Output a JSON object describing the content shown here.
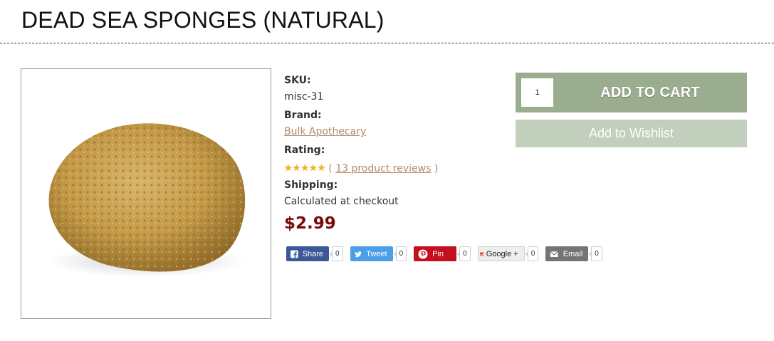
{
  "page": {
    "title": "DEAD SEA SPONGES (NATURAL)"
  },
  "product": {
    "image_alt": "Dead sea sponge",
    "sku_label": "SKU:",
    "sku_value": "misc-31",
    "brand_label": "Brand:",
    "brand_value": "Bulk Apothecary",
    "rating_label": "Rating:",
    "rating_stars": 5,
    "reviews_open": "(",
    "reviews_link": "13 product reviews",
    "reviews_close": ")",
    "shipping_label": "Shipping:",
    "shipping_value": "Calculated at checkout",
    "price": "$2.99"
  },
  "cart": {
    "quantity": "1",
    "add_to_cart_label": "ADD TO CART",
    "wishlist_label": "Add to Wishlist"
  },
  "share": [
    {
      "label": "Share",
      "count": "0",
      "icon": "facebook-icon"
    },
    {
      "label": "Tweet",
      "count": "0",
      "icon": "twitter-icon"
    },
    {
      "label": "Pin",
      "count": "0",
      "icon": "pinterest-icon"
    },
    {
      "label": "Google +",
      "count": "0",
      "icon": "google-plus-icon"
    },
    {
      "label": "Email",
      "count": "0",
      "icon": "email-icon"
    }
  ],
  "colors": {
    "cart_green": "#9aad8e",
    "wishlist_green": "#c2cfbd",
    "price_red": "#7a0a0a",
    "link_tan": "#b08b6a",
    "facebook": "#3b5998",
    "twitter": "#4a9fe8",
    "pinterest": "#c30f1f",
    "email": "#747474"
  }
}
